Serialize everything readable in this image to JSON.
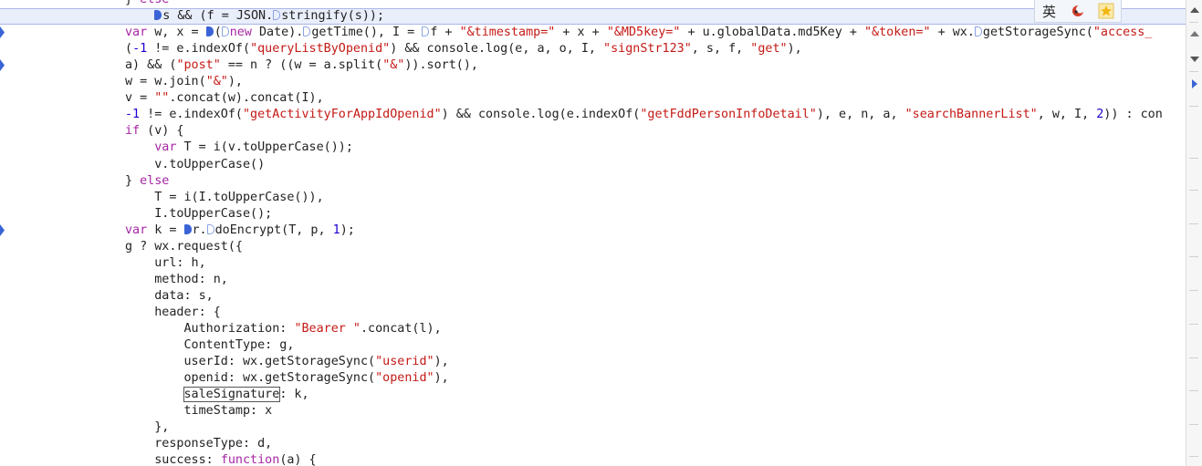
{
  "code_lines": [
    {
      "tokens": [
        {
          "t": "} ",
          "c": ""
        },
        {
          "t": "else",
          "c": "kw"
        }
      ],
      "marker": "",
      "highlight": false,
      "cut": true
    },
    {
      "tokens": [
        {
          "t": "    ",
          "c": ""
        },
        {
          "bp": "solid"
        },
        {
          "t": "s && (f = JSON.",
          "c": ""
        },
        {
          "bp": "hollow"
        },
        {
          "t": "stringify(s));",
          "c": ""
        }
      ],
      "marker": "",
      "highlight": true
    },
    {
      "tokens": [
        {
          "t": "var",
          "c": "kw"
        },
        {
          "t": " w, x = ",
          "c": ""
        },
        {
          "bp": "solid"
        },
        {
          "t": "(",
          "c": ""
        },
        {
          "bp": "hollow"
        },
        {
          "t": "new",
          "c": "kw"
        },
        {
          "t": " Date).",
          "c": ""
        },
        {
          "bp": "hollow"
        },
        {
          "t": "getTime(), I = ",
          "c": ""
        },
        {
          "bp": "hollow"
        },
        {
          "t": "f + ",
          "c": ""
        },
        {
          "t": "\"&timestamp=\"",
          "c": "str"
        },
        {
          "t": " + x + ",
          "c": ""
        },
        {
          "t": "\"&MD5key=\"",
          "c": "str"
        },
        {
          "t": " + u.globalData.md5Key + ",
          "c": ""
        },
        {
          "t": "\"&token=\"",
          "c": "str"
        },
        {
          "t": " + wx.",
          "c": ""
        },
        {
          "bp": "hollow"
        },
        {
          "t": "getStorageSync(",
          "c": ""
        },
        {
          "t": "\"access_",
          "c": "str"
        }
      ],
      "marker": "arrow",
      "highlight": false
    },
    {
      "tokens": [
        {
          "t": "(",
          "c": ""
        },
        {
          "t": "-1",
          "c": "num"
        },
        {
          "t": " != e.indexOf(",
          "c": ""
        },
        {
          "t": "\"queryListByOpenid\"",
          "c": "str"
        },
        {
          "t": ") && console.log(e, a, o, I, ",
          "c": ""
        },
        {
          "t": "\"signStr123\"",
          "c": "str"
        },
        {
          "t": ", s, f, ",
          "c": ""
        },
        {
          "t": "\"get\"",
          "c": "str"
        },
        {
          "t": "),",
          "c": ""
        }
      ],
      "marker": "",
      "highlight": false
    },
    {
      "tokens": [
        {
          "t": "a) && (",
          "c": ""
        },
        {
          "t": "\"post\"",
          "c": "str"
        },
        {
          "t": " == n ? ((w = a.split(",
          "c": ""
        },
        {
          "t": "\"&\"",
          "c": "str"
        },
        {
          "t": ")).sort(),",
          "c": ""
        }
      ],
      "marker": "arrow",
      "highlight": false
    },
    {
      "tokens": [
        {
          "t": "w = w.join(",
          "c": ""
        },
        {
          "t": "\"&\"",
          "c": "str"
        },
        {
          "t": "),",
          "c": ""
        }
      ],
      "marker": "",
      "highlight": false
    },
    {
      "tokens": [
        {
          "t": "v = ",
          "c": ""
        },
        {
          "t": "\"\"",
          "c": "str"
        },
        {
          "t": ".concat(w).concat(I),",
          "c": ""
        }
      ],
      "marker": "",
      "highlight": false
    },
    {
      "tokens": [
        {
          "t": "-1",
          "c": "num"
        },
        {
          "t": " != e.indexOf(",
          "c": ""
        },
        {
          "t": "\"getActivityForAppIdOpenid\"",
          "c": "str"
        },
        {
          "t": ") && console.log(e.indexOf(",
          "c": ""
        },
        {
          "t": "\"getFddPersonInfoDetail\"",
          "c": "str"
        },
        {
          "t": "), e, n, a, ",
          "c": ""
        },
        {
          "t": "\"searchBannerList\"",
          "c": "str"
        },
        {
          "t": ", w, I, ",
          "c": ""
        },
        {
          "t": "2",
          "c": "num"
        },
        {
          "t": ")) : con",
          "c": ""
        }
      ],
      "marker": "",
      "highlight": false
    },
    {
      "tokens": [
        {
          "t": "if",
          "c": "kw"
        },
        {
          "t": " (v) {",
          "c": ""
        }
      ],
      "marker": "",
      "highlight": false
    },
    {
      "tokens": [
        {
          "t": "    ",
          "c": ""
        },
        {
          "t": "var",
          "c": "kw"
        },
        {
          "t": " T = i(v.toUpperCase());",
          "c": ""
        }
      ],
      "marker": "",
      "highlight": false
    },
    {
      "tokens": [
        {
          "t": "    v.toUpperCase()",
          "c": ""
        }
      ],
      "marker": "",
      "highlight": false
    },
    {
      "tokens": [
        {
          "t": "} ",
          "c": ""
        },
        {
          "t": "else",
          "c": "kw"
        }
      ],
      "marker": "",
      "highlight": false
    },
    {
      "tokens": [
        {
          "t": "    T = i(I.toUpperCase()),",
          "c": ""
        }
      ],
      "marker": "",
      "highlight": false
    },
    {
      "tokens": [
        {
          "t": "    I.toUpperCase();",
          "c": ""
        }
      ],
      "marker": "",
      "highlight": false
    },
    {
      "tokens": [
        {
          "t": "var",
          "c": "kw"
        },
        {
          "t": " k = ",
          "c": ""
        },
        {
          "bp": "solid"
        },
        {
          "t": "r.",
          "c": ""
        },
        {
          "bp": "hollow"
        },
        {
          "t": "doEncrypt(T, p, ",
          "c": ""
        },
        {
          "t": "1",
          "c": "num"
        },
        {
          "t": ");",
          "c": ""
        }
      ],
      "marker": "arrow",
      "highlight": false
    },
    {
      "tokens": [
        {
          "t": "g ? wx.request({",
          "c": ""
        }
      ],
      "marker": "",
      "highlight": false
    },
    {
      "tokens": [
        {
          "t": "    url: h,",
          "c": ""
        }
      ],
      "marker": "",
      "highlight": false
    },
    {
      "tokens": [
        {
          "t": "    method: n,",
          "c": ""
        }
      ],
      "marker": "",
      "highlight": false
    },
    {
      "tokens": [
        {
          "t": "    data: s,",
          "c": ""
        }
      ],
      "marker": "",
      "highlight": false
    },
    {
      "tokens": [
        {
          "t": "    header: {",
          "c": ""
        }
      ],
      "marker": "",
      "highlight": false
    },
    {
      "tokens": [
        {
          "t": "        Authorization: ",
          "c": ""
        },
        {
          "t": "\"Bearer \"",
          "c": "str"
        },
        {
          "t": ".concat(l),",
          "c": ""
        }
      ],
      "marker": "",
      "highlight": false
    },
    {
      "tokens": [
        {
          "t": "        ContentType: g,",
          "c": ""
        }
      ],
      "marker": "",
      "highlight": false
    },
    {
      "tokens": [
        {
          "t": "        userId: wx.getStorageSync(",
          "c": ""
        },
        {
          "t": "\"userid\"",
          "c": "str"
        },
        {
          "t": "),",
          "c": ""
        }
      ],
      "marker": "",
      "highlight": false
    },
    {
      "tokens": [
        {
          "t": "        openid: wx.getStorageSync(",
          "c": ""
        },
        {
          "t": "\"openid\"",
          "c": "str"
        },
        {
          "t": "),",
          "c": ""
        }
      ],
      "marker": "",
      "highlight": false
    },
    {
      "tokens": [
        {
          "t": "        ",
          "c": ""
        },
        {
          "t": "saleSignature",
          "c": "boxed"
        },
        {
          "t": ": k,",
          "c": ""
        }
      ],
      "marker": "",
      "highlight": false
    },
    {
      "tokens": [
        {
          "t": "        timeStamp: x",
          "c": ""
        }
      ],
      "marker": "",
      "highlight": false
    },
    {
      "tokens": [
        {
          "t": "    },",
          "c": ""
        }
      ],
      "marker": "",
      "highlight": false
    },
    {
      "tokens": [
        {
          "t": "    responseType: d,",
          "c": ""
        }
      ],
      "marker": "",
      "highlight": false
    },
    {
      "tokens": [
        {
          "t": "    success: ",
          "c": ""
        },
        {
          "t": "function",
          "c": "kw"
        },
        {
          "t": "(a) {",
          "c": ""
        }
      ],
      "marker": "",
      "highlight": false
    }
  ],
  "ime_toolbar": {
    "lang_label": "英",
    "moon_icon": "moon-icon",
    "star_icon": "star-icon"
  },
  "scrollbar_icons": [
    "chevron-up-icon",
    "chevron-down-icon",
    "arrow-right-icon"
  ],
  "colors": {
    "keyword": "#a626a4",
    "string": "#c41a16",
    "number": "#1c00cf",
    "highlight": "#e9eefb",
    "breakpoint": "#3a63d6"
  }
}
